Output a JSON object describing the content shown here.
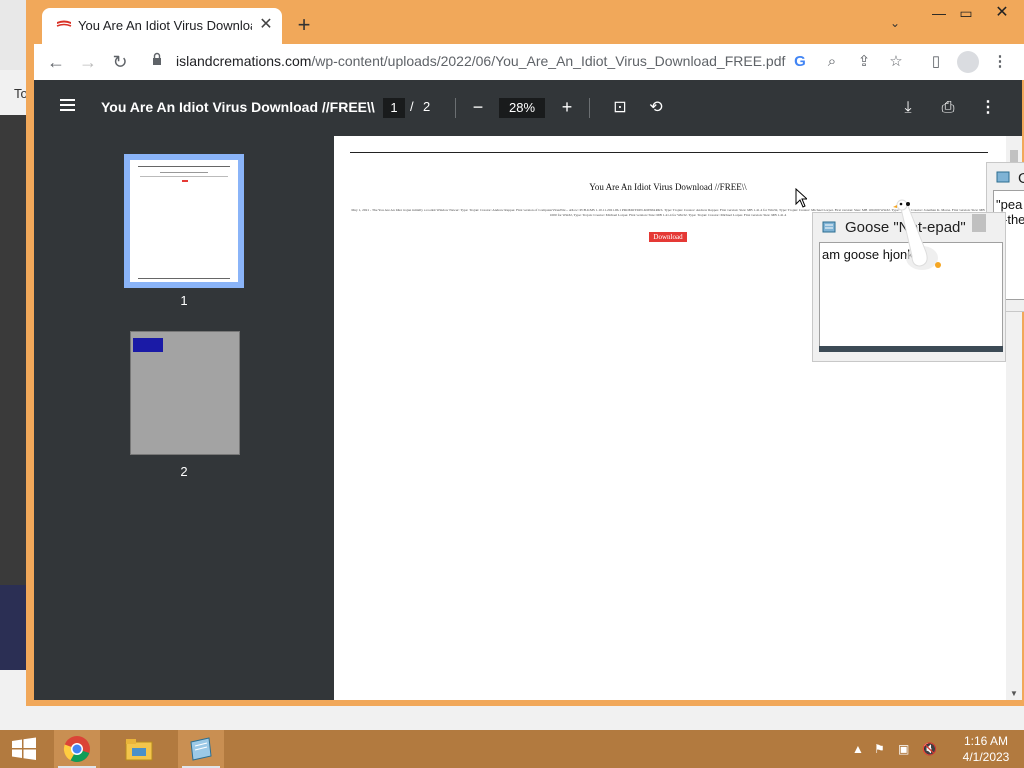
{
  "browser": {
    "tab_title": "You Are An Idiot Virus Download //FREE\\\\",
    "url_domain": "islandcremations.com",
    "url_path": "/wp-content/uploads/2022/06/You_Are_An_Idiot_Virus_Download_FREE.pdf"
  },
  "background_page": {
    "peek_text": "To"
  },
  "pdf_viewer": {
    "title": "You Are An Idiot Virus Download //FREE\\\\",
    "current_page": "1",
    "page_separator": "/",
    "total_pages": "2",
    "zoom": "28%",
    "thumbnails": [
      {
        "label": "1"
      },
      {
        "label": "2"
      }
    ]
  },
  "pdf_page": {
    "heading": "You Are An Idiot Virus Download //FREE\\\\",
    "body_text": "May 1, 2021 - The You Are An Idiot trojan initially a rootkit Window Newer: Type: Trojan: Creator: Andrew Repper. First version of ComputerVirusWiz... Allow: PCB-KMS 1.10.11.2021.06.1 PROMOTION-KMSPARKS. Type: Trojan: Creator: Andrew Repper. First version: Size: MB 1.41.4 for Win32, Type: Trojan: Creator: Michael Lorper. First version: Size: MB 100.000 Win32. Type: Trojan: Creator: Jonathan K. Morse. First version: Size: MB 1000 for Win32, Type: Trojan: Creator: Michael Lorper. First version: Size: MB 1.41.4 for Win32. Type: Trojan: Creator: Michael Lorper. First version: Size: MB 1.41.4",
    "download_label": "Download"
  },
  "goose_notepad": {
    "title": "Goose \"Not-epad\"",
    "body": "am goose hjonk"
  },
  "goose_notepad_2": {
    "title": "G",
    "body_line1": "\"pea",
    "body_line2": "-the"
  },
  "taskbar": {
    "time": "1:16 AM",
    "date": "4/1/2023"
  },
  "colors": {
    "window_frame": "#f1a85a",
    "pdf_toolbar": "#323639",
    "thumbnail_selected": "#8ab4f8",
    "download_button": "#e53935",
    "taskbar": "#b27a3f"
  },
  "icons": [
    "chrome-icon",
    "file-explorer-icon",
    "notepad-icon",
    "windows-start-icon",
    "goose-icon"
  ]
}
